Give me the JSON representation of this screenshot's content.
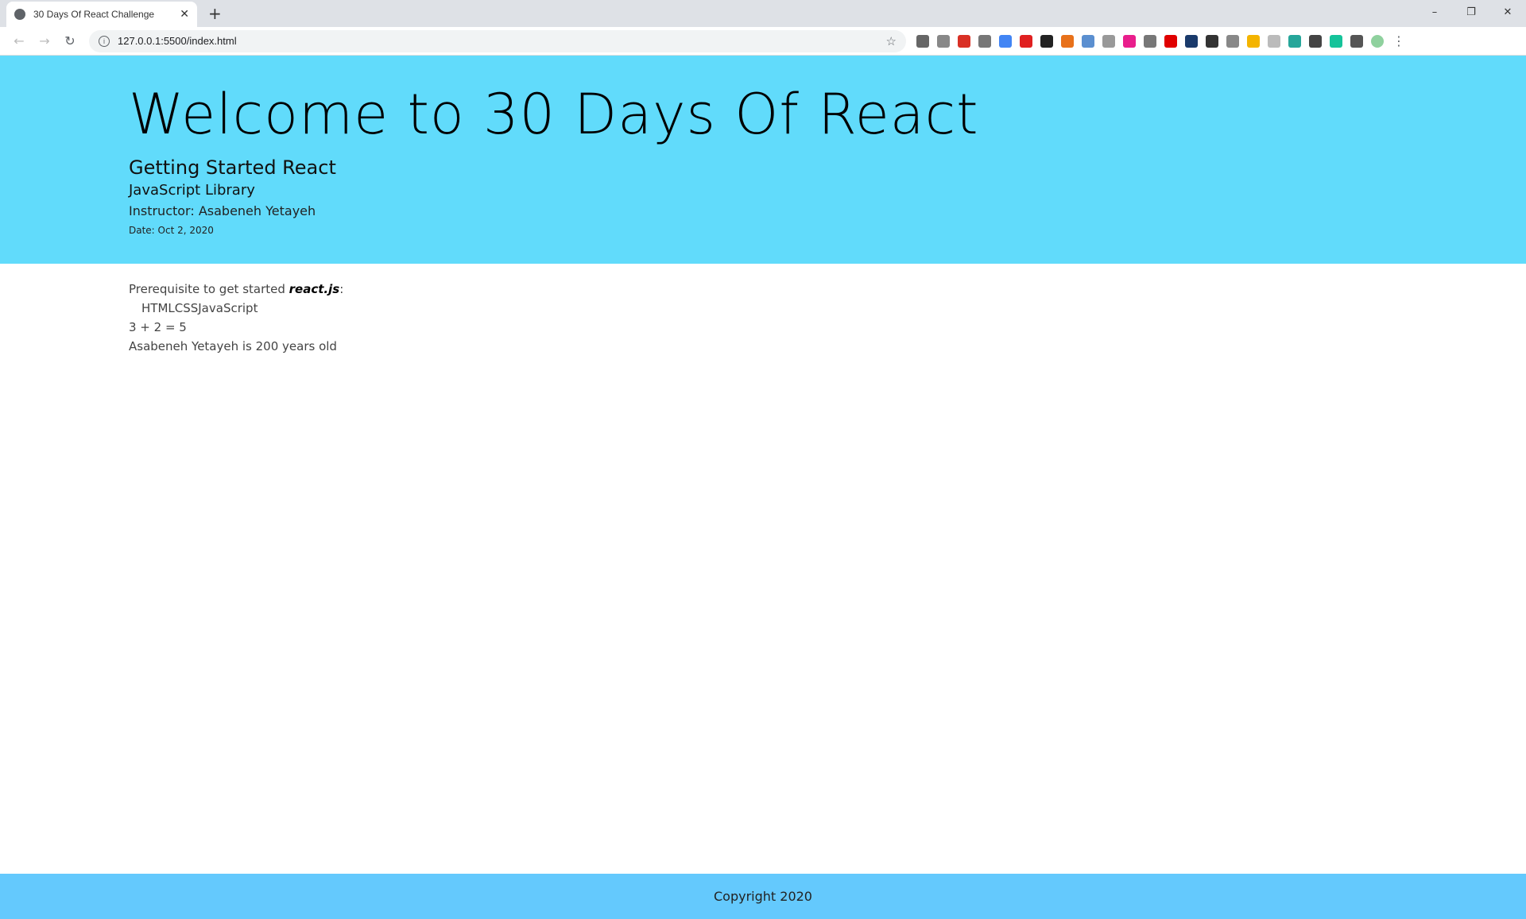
{
  "browser": {
    "tab_title": "30 Days Of React Challenge",
    "url": "127.0.0.1:5500/index.html",
    "extensions": [
      "#666",
      "#888",
      "#d93025",
      "#777",
      "#4285f4",
      "#e02020",
      "#222",
      "#e8711a",
      "#5b8fd0",
      "#999",
      "#e91e8c",
      "#777",
      "#e00000",
      "#1a3a6b",
      "#333",
      "#888",
      "#f4b400",
      "#bbb",
      "#26a69a",
      "#444",
      "#15c39a",
      "#555",
      "#8fd19e"
    ]
  },
  "header": {
    "title": "Welcome to 30 Days Of React",
    "subtitle": "Getting Started React",
    "library": "JavaScript Library",
    "instructor": "Instructor: Asabeneh Yetayeh",
    "date": "Date: Oct 2, 2020"
  },
  "main": {
    "prereq_text": "Prerequisite to get started ",
    "prereq_bold": "react.js",
    "prereq_end": ":",
    "techs": "HTMLCSSJavaScript",
    "sum": "3 + 2 = 5",
    "age": "Asabeneh Yetayeh is 200 years old"
  },
  "footer": {
    "copyright": "Copyright 2020"
  }
}
